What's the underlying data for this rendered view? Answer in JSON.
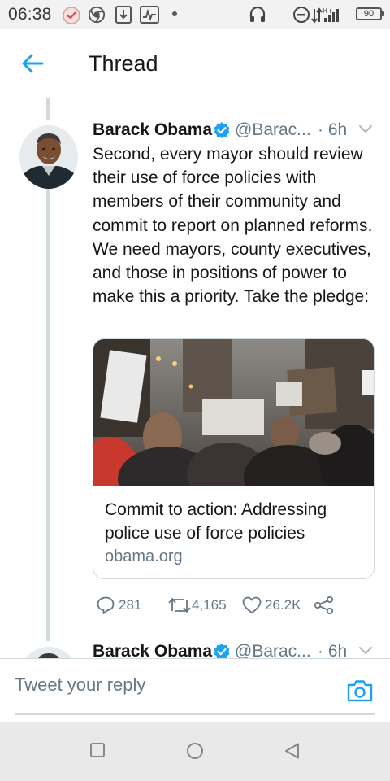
{
  "status_bar": {
    "time": "06:38",
    "battery": "90",
    "icons": [
      "notification-icon",
      "chrome-icon",
      "download-icon",
      "activity-icon",
      "dot-icon",
      "headset-icon",
      "dnd-icon",
      "signal-icon",
      "battery-icon"
    ]
  },
  "header": {
    "title": "Thread",
    "back_icon": "back-arrow-icon"
  },
  "tweet": {
    "author": "Barack Obama",
    "handle": "@Barac...",
    "time_ago": "· 6h",
    "text": "Second, every mayor should review their use of force policies with members of their community and commit to report on planned reforms. We need mayors, county executives, and those in positions of power to make this a priority. Take the pledge:",
    "card": {
      "title": "Commit to action: Addressing police use of force policies",
      "domain": "obama.org"
    },
    "actions": {
      "replies": "281",
      "retweets": "4,165",
      "likes": "26.2K"
    }
  },
  "next_tweet": {
    "author": "Barack Obama",
    "handle": "@Barac...",
    "time_ago": "· 6h"
  },
  "reply_bar": {
    "placeholder": "Tweet your reply"
  },
  "colors": {
    "accent": "#1da1f2",
    "secondary_text": "#657786",
    "divider": "#cfd9de"
  }
}
